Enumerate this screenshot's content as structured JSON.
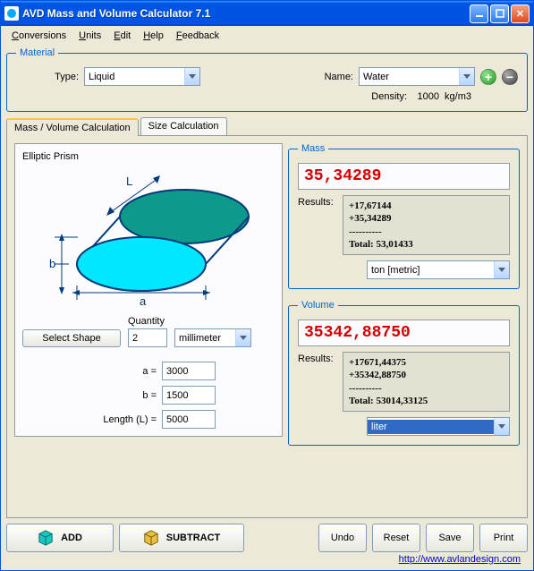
{
  "window": {
    "title": "AVD Mass and Volume Calculator 7.1"
  },
  "menu": {
    "conversions": "Conversions",
    "units": "Units",
    "edit": "Edit",
    "help": "Help",
    "feedback": "Feedback"
  },
  "material": {
    "legend": "Material",
    "type_label": "Type:",
    "type_value": "Liquid",
    "name_label": "Name:",
    "name_value": "Water",
    "density_label": "Density:",
    "density_value": "1000",
    "density_unit": "kg/m3"
  },
  "tabs": {
    "calc": "Mass / Volume  Calculation",
    "size": "Size Calculation"
  },
  "shape": {
    "title": "Elliptic Prism",
    "select_label": "Select Shape",
    "quantity_label": "Quantity",
    "quantity_value": "2",
    "unit_value": "millimeter",
    "a_label": "a =",
    "a_value": "3000",
    "b_label": "b =",
    "b_value": "1500",
    "len_label": "Length (L) =",
    "len_value": "5000",
    "dim_a": "a",
    "dim_b": "b",
    "dim_L": "L"
  },
  "mass": {
    "legend": "Mass",
    "value": "35,34289",
    "results_label": "Results:",
    "results_text": "+17,67144\n+35,34289\n----------\nTotal: 53,01433",
    "unit": "ton [metric]"
  },
  "volume": {
    "legend": "Volume",
    "value": "35342,88750",
    "results_label": "Results:",
    "results_text": "+17671,44375\n+35342,88750\n----------\nTotal: 53014,33125",
    "unit": "liter"
  },
  "buttons": {
    "add": "ADD",
    "subtract": "SUBTRACT",
    "undo": "Undo",
    "reset": "Reset",
    "save": "Save",
    "print": "Print"
  },
  "footer": {
    "url": "http://www.avlandesign.com"
  }
}
